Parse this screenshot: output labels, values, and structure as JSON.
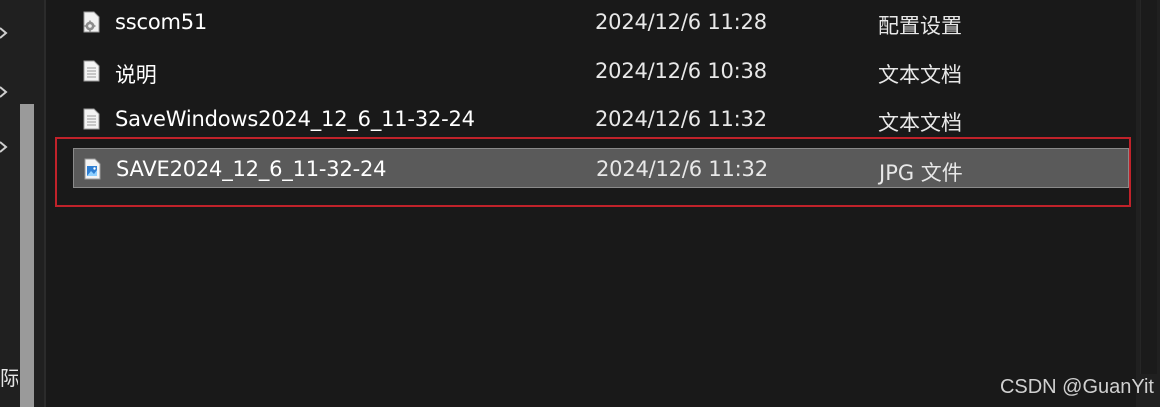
{
  "nav": {
    "partial_label": "际("
  },
  "files": [
    {
      "name": "sscom51",
      "date": "2024/12/6 11:28",
      "type": "配置设置",
      "icon": "settings-file-icon"
    },
    {
      "name": "说明",
      "date": "2024/12/6 10:38",
      "type": "文本文档",
      "icon": "text-file-icon"
    },
    {
      "name": "SaveWindows2024_12_6_11-32-24",
      "date": "2024/12/6 11:32",
      "type": "文本文档",
      "icon": "text-file-icon"
    },
    {
      "name": "SAVE2024_12_6_11-32-24",
      "date": "2024/12/6 11:32",
      "type": "JPG 文件",
      "icon": "image-file-icon",
      "selected": true
    }
  ],
  "watermark": "CSDN @GuanYit",
  "colors": {
    "background": "#191919",
    "selected_row": "#5a5a5a",
    "highlight_border": "#c0222a"
  }
}
